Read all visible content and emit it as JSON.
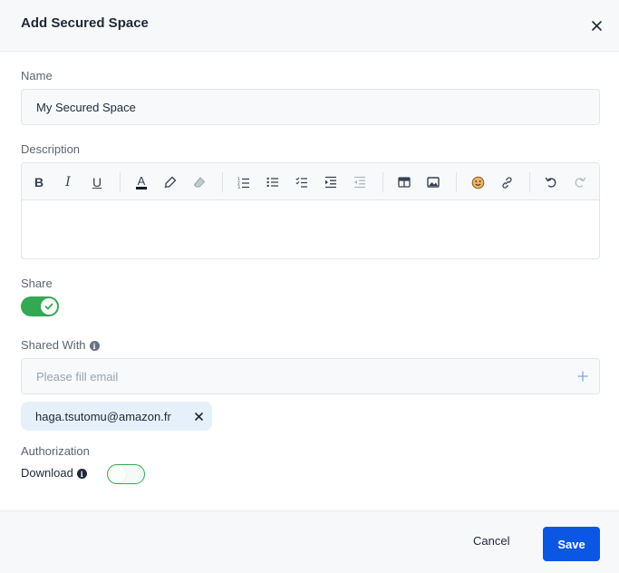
{
  "dialog": {
    "title": "Add Secured Space"
  },
  "form": {
    "name_label": "Name",
    "name_value": "My Secured Space",
    "description_label": "Description",
    "share_label": "Share",
    "share_enabled": true,
    "shared_with_label": "Shared With",
    "email_placeholder": "Please fill email",
    "shared_emails": [
      "haga.tsutomu@amazon.fr"
    ],
    "authorization_label": "Authorization",
    "download_label": "Download",
    "download_enabled": false
  },
  "toolbar": {
    "icons": [
      "bold-icon",
      "italic-icon",
      "underline-icon",
      "text-color-icon",
      "highlight-icon",
      "eraser-icon",
      "numbered-list-icon",
      "bullet-list-icon",
      "checklist-icon",
      "indent-icon",
      "outdent-icon",
      "table-icon",
      "image-icon",
      "emoji-icon",
      "link-icon",
      "undo-icon",
      "redo-icon"
    ],
    "bold_glyph": "B",
    "italic_glyph": "I",
    "underline_glyph": "U",
    "text_color_glyph": "A"
  },
  "footer": {
    "cancel_label": "Cancel",
    "save_label": "Save"
  },
  "colors": {
    "primary": "#0b57e3",
    "toggle_on": "#34a853",
    "chip_bg": "#e6f0fa"
  }
}
